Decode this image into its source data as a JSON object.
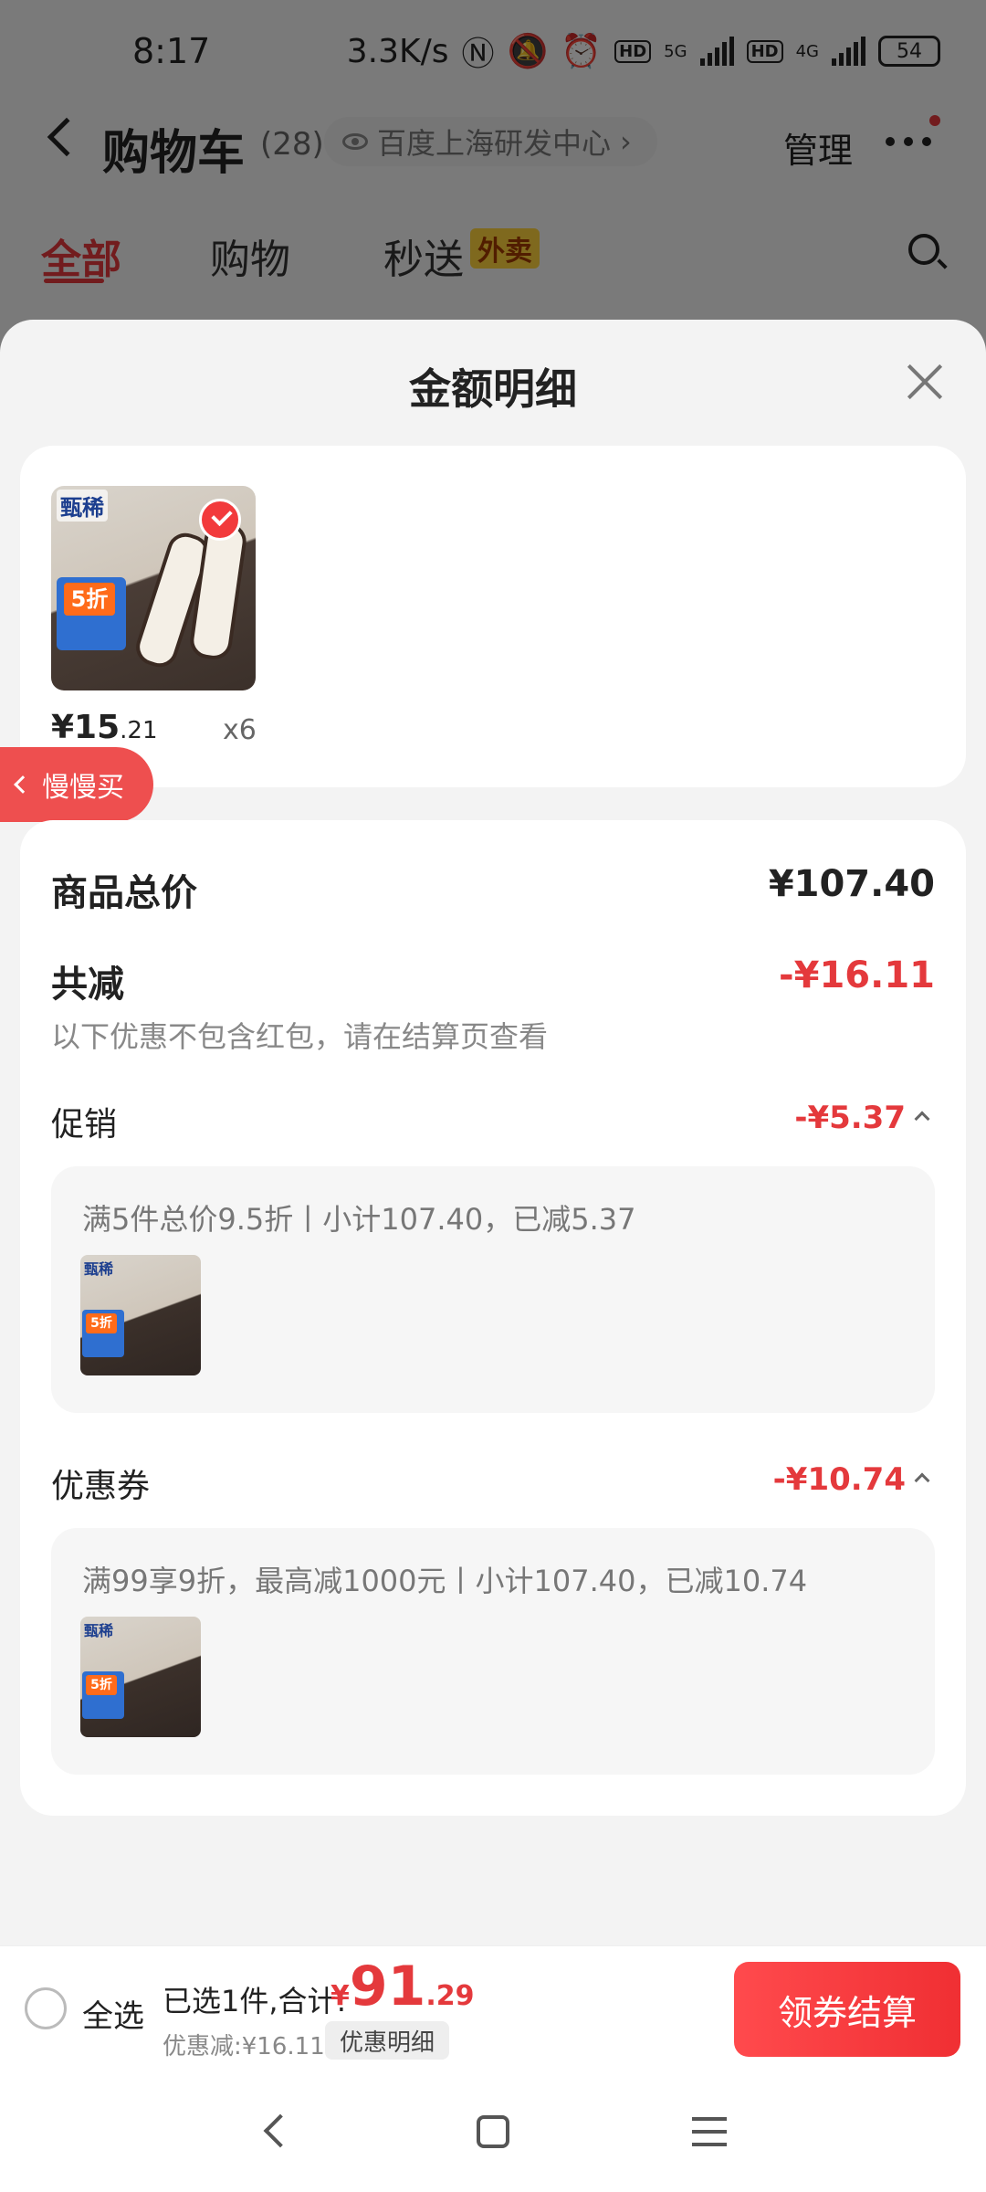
{
  "status_bar": {
    "time": "8:17",
    "net_speed": "3.3K/s",
    "hd1": "HD",
    "net1": "5G",
    "hd2": "HD",
    "net2": "4G",
    "battery": "54"
  },
  "header": {
    "title": "购物车",
    "count": "(28)",
    "location": "百度上海研发中心",
    "location_chevron": "›",
    "manage": "管理"
  },
  "tabs": [
    {
      "label": "全部",
      "active": true
    },
    {
      "label": "购物"
    },
    {
      "label": "秒送"
    }
  ],
  "tab_badge": "外卖",
  "sheet": {
    "title": "金额明细"
  },
  "product": {
    "brand": "甄稀",
    "thumb_tag": "5折",
    "price_main": "¥15",
    "price_decimal": ".21",
    "quantity": "x6"
  },
  "slow_buy": "慢慢买",
  "summary": {
    "total_label": "商品总价",
    "total_value": "¥107.40",
    "reduce_label": "共减",
    "reduce_value": "-¥16.11",
    "note": "以下优惠不包含红包，请在结算页查看"
  },
  "promotion": {
    "label": "促销",
    "value": "-¥5.37",
    "detail": "满5件总价9.5折丨小计107.40，已减5.37"
  },
  "coupon": {
    "label": "优惠券",
    "value": "-¥10.74",
    "detail": "满99享9折，最高减1000元丨小计107.40，已减10.74"
  },
  "checkout": {
    "select_all": "全选",
    "selected": "已选1件,合计:",
    "currency": "¥",
    "total_int": "91",
    "total_dec": ".29",
    "discount": "优惠减:¥16.11",
    "detail_chip": "优惠明细",
    "button": "领券结算"
  },
  "colors": {
    "accent": "#e4393c",
    "badge": "#ffd23c"
  },
  "icons": [
    "back-icon",
    "eye-icon",
    "more-icon",
    "search-icon",
    "close-icon",
    "check-icon",
    "chevron-up-icon",
    "nav-back-icon",
    "nav-home-icon",
    "nav-menu-icon"
  ]
}
